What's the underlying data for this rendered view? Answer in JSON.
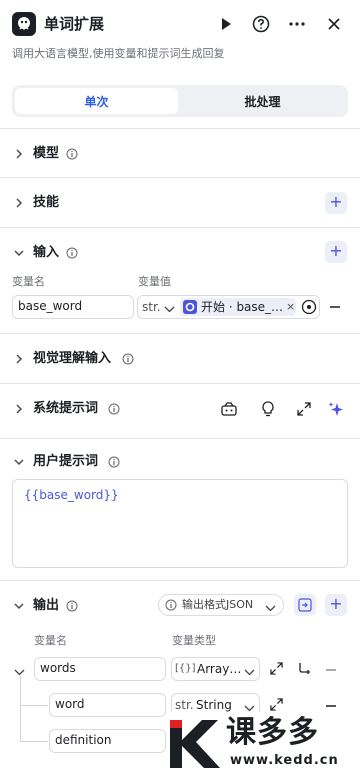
{
  "header": {
    "title": "单词扩展",
    "description": "调用大语言模型,使用变量和提示词生成回复"
  },
  "tabs": [
    {
      "label": "单次"
    },
    {
      "label": "批处理"
    }
  ],
  "sections": {
    "model": {
      "title": "模型"
    },
    "skills": {
      "title": "技能"
    },
    "input": {
      "title": "输入",
      "col_name": "变量名",
      "col_value": "变量值",
      "var_name": "base_word",
      "type_abbr": "str.",
      "ref_label": "开始 · base_…"
    },
    "vision": {
      "title": "视觉理解输入"
    },
    "system_prompt": {
      "title": "系统提示词"
    },
    "user_prompt": {
      "title": "用户提示词",
      "content": "{{base_word}}"
    },
    "output": {
      "title": "输出",
      "format_label": "输出格式JSON",
      "col_name": "变量名",
      "col_type": "变量类型",
      "rows": [
        {
          "name": "words",
          "type_icon": "[{}]",
          "type": "Array…"
        },
        {
          "name": "word",
          "type_icon": "str.",
          "type": "String"
        },
        {
          "name": "definition",
          "type_icon": "",
          "type": "ring"
        }
      ]
    }
  },
  "watermark": {
    "text": "课多多",
    "url": "www.kedd.cn"
  },
  "colors": {
    "accent": "#4c54d8",
    "tab_active": "#2d5fe6",
    "ref_chip": "#4c54d8"
  }
}
